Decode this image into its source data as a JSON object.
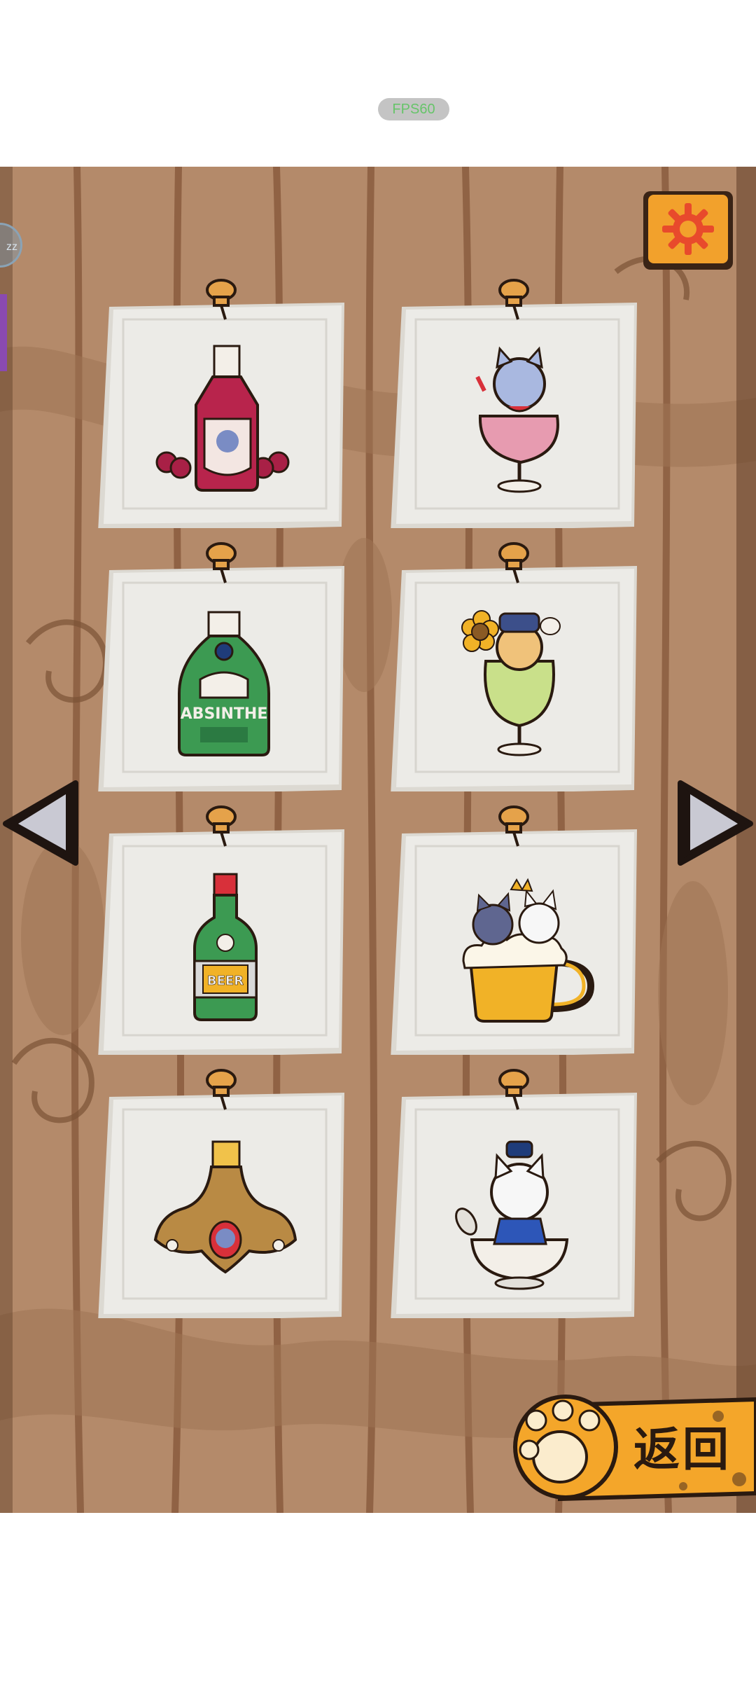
{
  "status": {
    "fps_text": "FPS60"
  },
  "board": {
    "drinks": [
      {
        "name": "wine-bottle-icon"
      },
      {
        "name": "cat-cocktail-glass-icon"
      },
      {
        "name": "absinthe-bottle-icon",
        "label": "ABSINTHE"
      },
      {
        "name": "cat-sunflower-cocktail-icon"
      },
      {
        "name": "beer-bottle-icon",
        "label": "BEER"
      },
      {
        "name": "cats-beer-mug-icon"
      },
      {
        "name": "ornate-liquor-bottle-icon"
      },
      {
        "name": "cat-sake-bowl-icon"
      }
    ]
  },
  "navigation": {
    "prev": "left-arrow-icon",
    "next": "right-arrow-icon"
  },
  "back_button": {
    "label": "返回"
  },
  "side_sliver": {
    "text": "zz"
  },
  "colors": {
    "wood": "#b48a6a",
    "wood_dark": "#7a5236",
    "paper": "#ecebe7",
    "pin": "#e5a24a",
    "settings_orange": "#f2a12c",
    "paw_orange": "#f4a62a",
    "arrow_gray": "#c9c9d3"
  }
}
